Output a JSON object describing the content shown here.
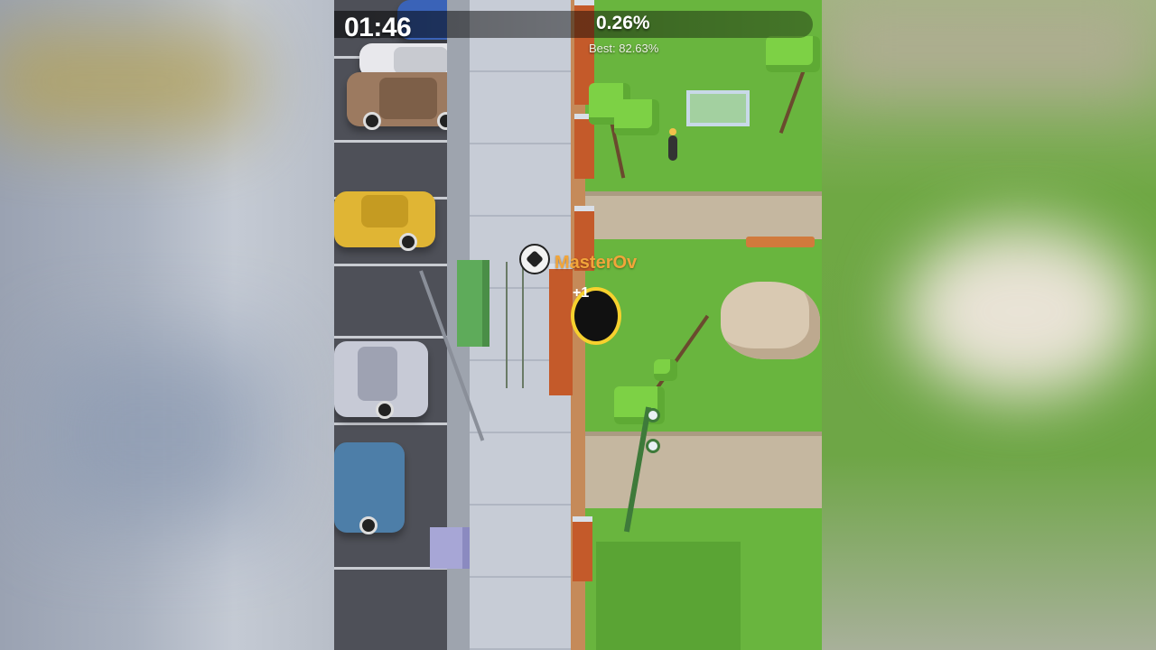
{
  "hud": {
    "timer": "01:46",
    "percent": "0.26%",
    "best": "Best: 82.63%"
  },
  "player": {
    "name": "MasterOv",
    "gain_indicator": "+1"
  },
  "colors": {
    "hole_ring": "#f7d12e",
    "player_name": "#f2a53a",
    "grass": "#69b53e"
  }
}
